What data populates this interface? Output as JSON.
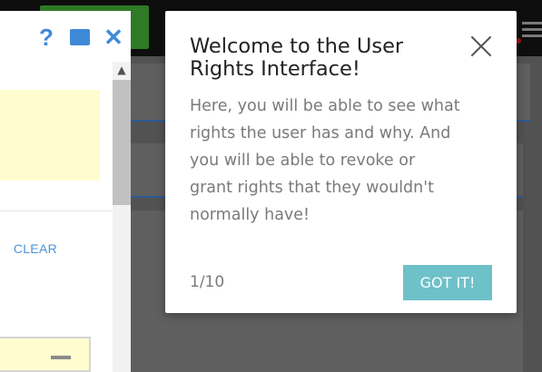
{
  "side_panel": {
    "icons": [
      "help-icon",
      "window-icon",
      "close-icon"
    ],
    "clear_label": "CLEAR"
  },
  "dialog": {
    "title": "Welcome to the User Rights Interface!",
    "body": "Here, you will be able to see what rights the user has and why. And you will be able to revoke or grant rights that they wouldn't normally have!",
    "progress": "1/10",
    "button_label": "GOT IT!"
  },
  "colors": {
    "accent_blue": "#3f8ad8",
    "button_teal": "#6ec1c9",
    "highlight_yellow": "#fffdd0"
  }
}
